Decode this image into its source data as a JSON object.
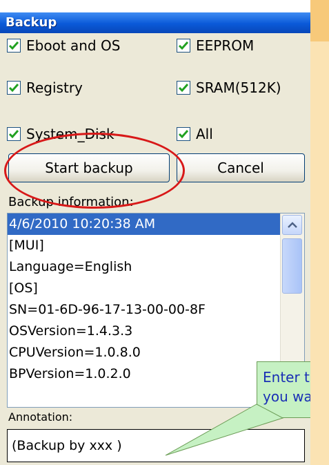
{
  "window": {
    "title": "Backup"
  },
  "checkboxes": [
    {
      "label": "Eboot and OS",
      "checked": true
    },
    {
      "label": "EEPROM",
      "checked": true
    },
    {
      "label": "Registry",
      "checked": true
    },
    {
      "label": "SRAM(512K)",
      "checked": true
    },
    {
      "label": "System_Disk",
      "checked": true
    },
    {
      "label": "All",
      "checked": true
    }
  ],
  "buttons": {
    "start": "Start backup",
    "cancel": "Cancel"
  },
  "info": {
    "label": "Backup information:",
    "lines": [
      "4/6/2010 10:20:38 AM",
      "[MUI]",
      "Language=English",
      "[OS]",
      "SN=01-6D-96-17-13-00-00-8F",
      "OSVersion=1.4.3.3",
      "CPUVersion=1.0.8.0",
      "BPVersion=1.0.2.0"
    ],
    "selected_index": 0
  },
  "annotation": {
    "label": "Annotation:",
    "value": "(Backup by xxx )"
  },
  "callout": {
    "line1": "Enter th",
    "line2": "you war"
  },
  "colors": {
    "title_bar": "#0a59d8",
    "selection": "#316ac5",
    "highlight_ellipse": "#d81818",
    "callout_bg": "#c6f1c3",
    "callout_text": "#1a2fb5"
  }
}
